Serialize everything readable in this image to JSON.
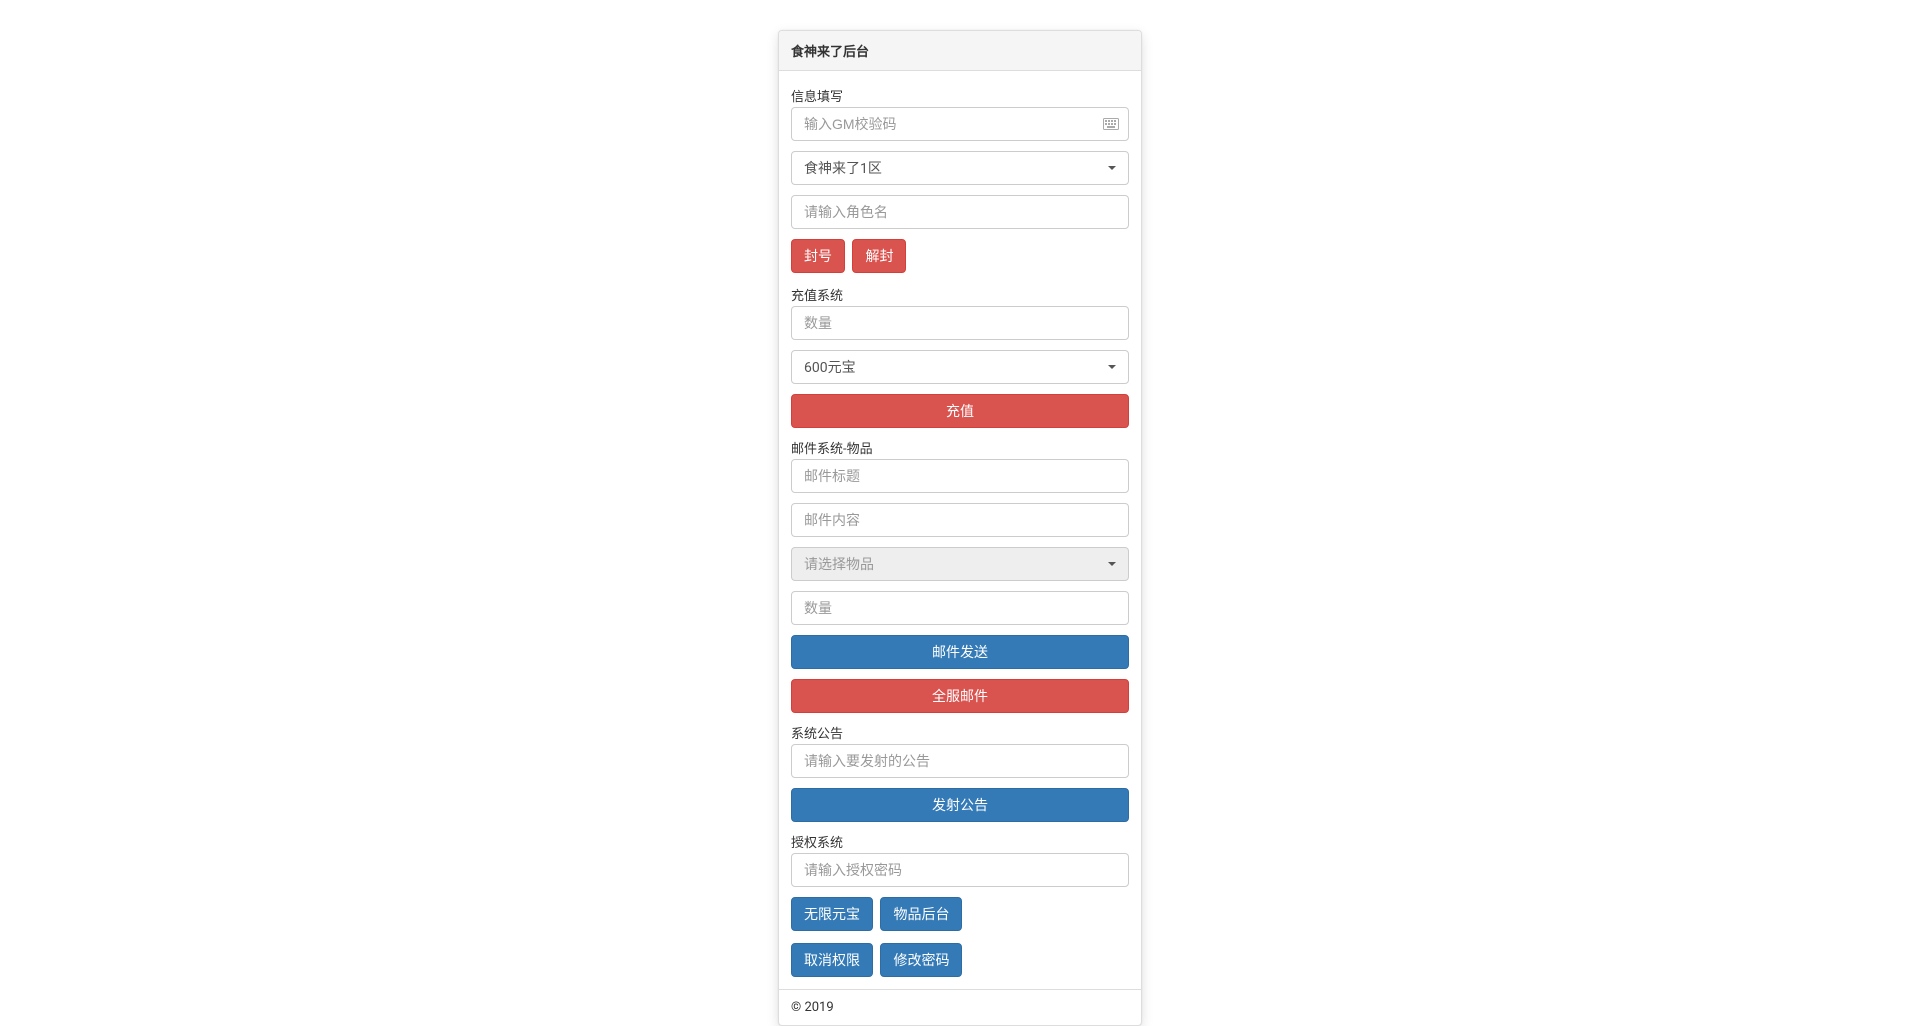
{
  "panel": {
    "title": "食神来了后台"
  },
  "info": {
    "label": "信息填写",
    "gm_code_placeholder": "输入GM校验码",
    "server_selected": "食神来了1区",
    "role_placeholder": "请输入角色名",
    "ban_label": "封号",
    "unban_label": "解封"
  },
  "recharge": {
    "label": "充值系统",
    "amount_placeholder": "数量",
    "item_selected": "600元宝",
    "submit_label": "充值"
  },
  "mail": {
    "label": "邮件系统-物品",
    "title_placeholder": "邮件标题",
    "content_placeholder": "邮件内容",
    "item_placeholder": "请选择物品",
    "amount_placeholder": "数量",
    "send_label": "邮件发送",
    "broadcast_label": "全服邮件"
  },
  "notice": {
    "label": "系统公告",
    "placeholder": "请输入要发射的公告",
    "submit_label": "发射公告"
  },
  "auth": {
    "label": "授权系统",
    "placeholder": "请输入授权密码",
    "unlimited_label": "无限元宝",
    "items_backend_label": "物品后台",
    "cancel_auth_label": "取消权限",
    "change_pw_label": "修改密码"
  },
  "footer": {
    "text": "© 2019"
  }
}
